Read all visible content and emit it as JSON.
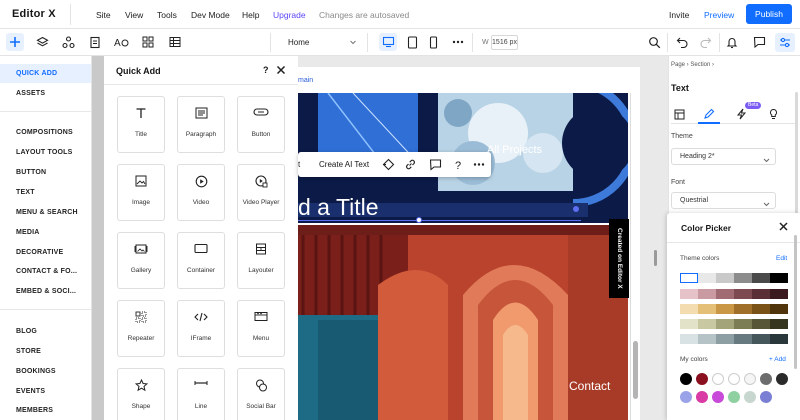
{
  "topbar": {
    "logo": "Editor X",
    "menu": [
      "Site",
      "View",
      "Tools",
      "Dev Mode",
      "Help"
    ],
    "upgrade": "Upgrade",
    "autosave": "Changes are autosaved",
    "invite": "Invite",
    "preview": "Preview",
    "publish": "Publish"
  },
  "toolbar": {
    "page": "Home",
    "width_label": "W",
    "width_value": "1516 px"
  },
  "sidebar": {
    "categories": [
      "QUICK ADD",
      "ASSETS",
      "COMPOSITIONS",
      "LAYOUT TOOLS",
      "BUTTON",
      "TEXT",
      "MENU & SEARCH",
      "MEDIA",
      "DECORATIVE",
      "CONTACT & FO...",
      "EMBED & SOCI...",
      "BLOG",
      "STORE",
      "BOOKINGS",
      "EVENTS",
      "MEMBERS"
    ]
  },
  "quick_add": {
    "title": "Quick Add",
    "help": "?",
    "tiles": [
      "Title",
      "Paragraph",
      "Button",
      "Image",
      "Video",
      "Video Player",
      "Gallery",
      "Container",
      "Layouter",
      "Repeater",
      "IFrame",
      "Menu",
      "Shape",
      "Line",
      "Social Bar"
    ]
  },
  "canvas": {
    "url_fragment": "main",
    "ai_bar_t": "t",
    "ai_bar_label": "Create AI Text",
    "title_fragment": "d a Title",
    "all_projects": "All Projects",
    "contact": "Contact",
    "badge": "Created on Editor X"
  },
  "inspector": {
    "breadcrumb": "Page  ›  Section  ›",
    "title": "Text",
    "beta": "Beta",
    "theme_label": "Theme",
    "theme_value": "Heading 2*",
    "font_label": "Font",
    "font_value": "Questrial"
  },
  "color_picker": {
    "title": "Color Picker",
    "theme_colors_label": "Theme colors",
    "edit": "Edit",
    "my_colors_label": "My colors",
    "add": "+ Add",
    "theme_rows": [
      [
        "#ffffff",
        "#e8e8e8",
        "#c9c9c9",
        "#8c8c8c",
        "#4a4a4a",
        "#000000"
      ],
      [
        "#e6c3c9",
        "#c99aa1",
        "#a06b73",
        "#7d4a52",
        "#5a2f36",
        "#3a1a1f"
      ],
      [
        "#f3ddb0",
        "#e4bf78",
        "#c99745",
        "#a0702a",
        "#7a5218",
        "#4f340c"
      ],
      [
        "#e2e2c8",
        "#c8c8a3",
        "#a4a47a",
        "#7c7c55",
        "#575738",
        "#36361f"
      ],
      [
        "#d8e1e3",
        "#b5c2c6",
        "#8e9fa4",
        "#677a80",
        "#46575c",
        "#2a383c"
      ]
    ],
    "my_colors_row1": [
      "#000000",
      "#8a1020",
      "#ffffff",
      "#ffffff",
      "#f5f5f5",
      "#6c6c6c",
      "#2a2a2a"
    ],
    "my_colors_row2": [
      "#9aa3e8",
      "#d93aa3",
      "#c84ad8",
      "#8fd0a1",
      "#c7d7cf",
      "#7b7fd3"
    ]
  }
}
